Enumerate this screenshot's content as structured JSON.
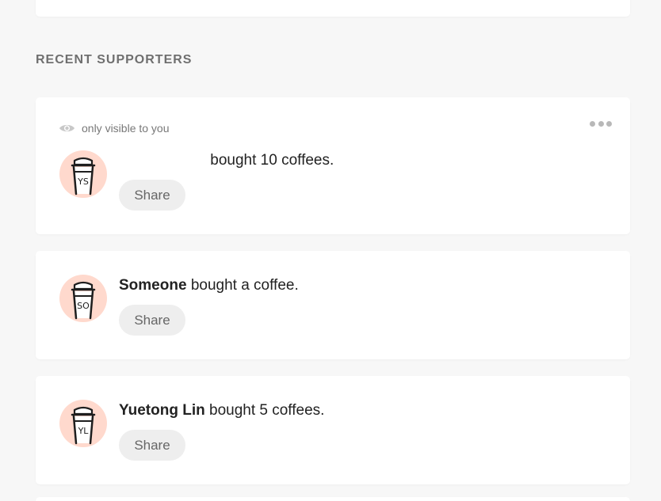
{
  "section": {
    "title": "RECENT SUPPORTERS"
  },
  "supporters": [
    {
      "visibility_label": "only visible to you",
      "initials": "YS",
      "name": "",
      "message": "bought 10 coffees.",
      "share_label": "Share"
    },
    {
      "initials": "SO",
      "name": "Someone",
      "message": "bought a coffee.",
      "share_label": "Share"
    },
    {
      "initials": "YL",
      "name": "Yuetong Lin",
      "message": "bought 5 coffees.",
      "share_label": "Share"
    }
  ],
  "icons": {
    "visibility": "eye-icon",
    "menu": "more-dots-icon",
    "avatar": "coffee-cup-icon"
  },
  "colors": {
    "background": "#f7f7f7",
    "avatar_bg": "#ffd9cd",
    "share_bg": "#eeeeee"
  }
}
